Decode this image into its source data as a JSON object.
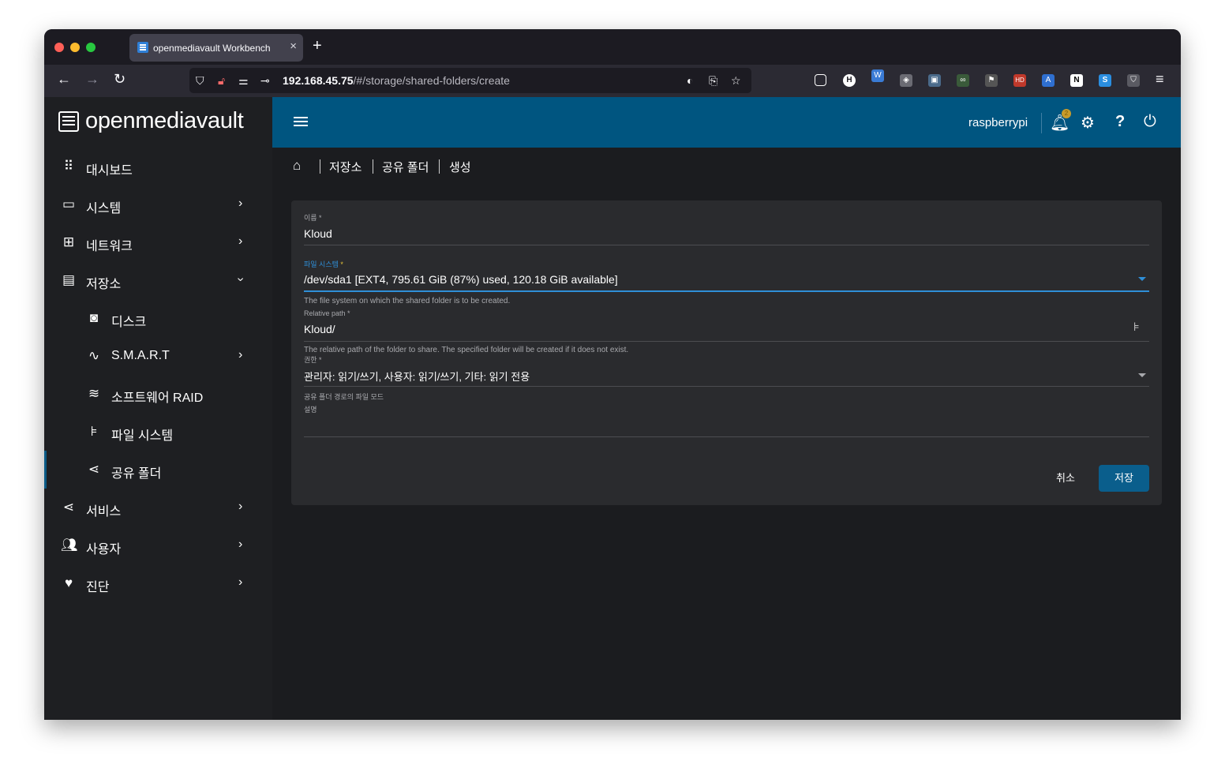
{
  "browser": {
    "tab_title": "openmediavault Workbench",
    "tab_close": "×",
    "new_tab": "+",
    "url_host": "192.168.45.75",
    "url_path": "/#/storage/shared-folders/create"
  },
  "app": {
    "logo_text": "openmediavault",
    "hostname": "raspberrypi",
    "notification_count": "2"
  },
  "sidebar": {
    "items": [
      {
        "label": "대시보드"
      },
      {
        "label": "시스템"
      },
      {
        "label": "네트워크"
      },
      {
        "label": "저장소"
      },
      {
        "label": "디스크"
      },
      {
        "label": "S.M.A.R.T"
      },
      {
        "label": "소프트웨어 RAID"
      },
      {
        "label": "파일 시스템"
      },
      {
        "label": "공유 폴더"
      },
      {
        "label": "서비스"
      },
      {
        "label": "사용자"
      },
      {
        "label": "진단"
      }
    ]
  },
  "breadcrumb": [
    "저장소",
    "공유 폴더",
    "생성"
  ],
  "form": {
    "name_label": "이름 *",
    "name_value": "Kloud",
    "fs_label": "파일 시스템",
    "fs_required": "*",
    "fs_value": "/dev/sda1 [EXT4, 795.61 GiB (87%) used, 120.18 GiB available]",
    "fs_hint": "The file system on which the shared folder is to be created.",
    "path_label": "Relative path *",
    "path_value": "Kloud/",
    "path_hint": "The relative path of the folder to share. The specified folder will be created if it does not exist.",
    "perm_label": "권한 *",
    "perm_value": "관리자: 읽기/쓰기, 사용자: 읽기/쓰기, 기타: 읽기 전용",
    "perm_hint": "공유 폴더 경로의 파일 모드",
    "desc_label": "설명",
    "cancel": "취소",
    "save": "저장"
  },
  "colors": {
    "topbar": "#005580",
    "accent": "#2f8fd8",
    "save_button": "#0a5e8c",
    "badge": "#c79b2b"
  }
}
